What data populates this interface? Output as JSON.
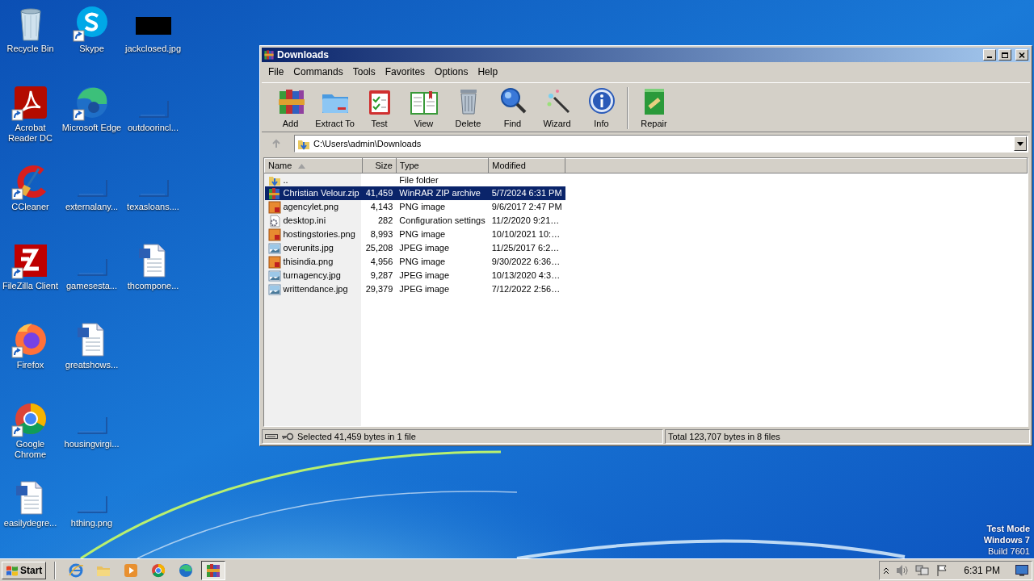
{
  "desktop_icons": [
    {
      "label": "Recycle Bin",
      "kind": "recycle",
      "shortcut": false
    },
    {
      "label": "Acrobat Reader DC",
      "kind": "acrobat",
      "shortcut": true
    },
    {
      "label": "CCleaner",
      "kind": "ccleaner",
      "shortcut": true
    },
    {
      "label": "FileZilla Client",
      "kind": "filezilla",
      "shortcut": true
    },
    {
      "label": "Firefox",
      "kind": "firefox",
      "shortcut": true
    },
    {
      "label": "Google Chrome",
      "kind": "chrome",
      "shortcut": true
    },
    {
      "label": "easilydegre...",
      "kind": "word",
      "shortcut": false
    },
    {
      "label": "Skype",
      "kind": "skype",
      "shortcut": true
    },
    {
      "label": "Microsoft Edge",
      "kind": "edge",
      "shortcut": true
    },
    {
      "label": "externalany...",
      "kind": "blank",
      "shortcut": false
    },
    {
      "label": "gamesesta...",
      "kind": "blank",
      "shortcut": false
    },
    {
      "label": "greatshows...",
      "kind": "word",
      "shortcut": false
    },
    {
      "label": "housingvirgi...",
      "kind": "blank",
      "shortcut": false
    },
    {
      "label": "hthing.png",
      "kind": "blank",
      "shortcut": false
    },
    {
      "label": "jackclosed.jpg",
      "kind": "black",
      "shortcut": false
    },
    {
      "label": "outdoorincl...",
      "kind": "blank",
      "shortcut": false
    },
    {
      "label": "texasloans....",
      "kind": "blank",
      "shortcut": false
    },
    {
      "label": "thcompone...",
      "kind": "word",
      "shortcut": false
    }
  ],
  "window": {
    "title": "Downloads",
    "menu": [
      "File",
      "Commands",
      "Tools",
      "Favorites",
      "Options",
      "Help"
    ],
    "toolbar": [
      {
        "label": "Add",
        "kind": "add",
        "separator_before": false
      },
      {
        "label": "Extract To",
        "kind": "extract",
        "separator_before": false
      },
      {
        "label": "Test",
        "kind": "test",
        "separator_before": false
      },
      {
        "label": "View",
        "kind": "view",
        "separator_before": false
      },
      {
        "label": "Delete",
        "kind": "delete",
        "separator_before": false
      },
      {
        "label": "Find",
        "kind": "find",
        "separator_before": false
      },
      {
        "label": "Wizard",
        "kind": "wizard",
        "separator_before": false
      },
      {
        "label": "Info",
        "kind": "info",
        "separator_before": false
      },
      {
        "label": "Repair",
        "kind": "repair",
        "separator_before": true
      }
    ],
    "address": {
      "path": "C:\\Users\\admin\\Downloads"
    },
    "file_list": {
      "columns": [
        {
          "label": "Name",
          "sorted": true
        },
        {
          "label": "Size",
          "sorted": false
        },
        {
          "label": "Type",
          "sorted": false
        },
        {
          "label": "Modified",
          "sorted": false
        }
      ],
      "rows": [
        {
          "name": "..",
          "size": "",
          "type": "File folder",
          "modified": "",
          "kind": "up",
          "selected": false
        },
        {
          "name": "Christian Velour.zip",
          "size": "41,459",
          "type": "WinRAR ZIP archive",
          "modified": "5/7/2024 6:31 PM",
          "kind": "zip",
          "selected": true
        },
        {
          "name": "agencylet.png",
          "size": "4,143",
          "type": "PNG image",
          "modified": "9/6/2017 2:47 PM",
          "kind": "png",
          "selected": false
        },
        {
          "name": "desktop.ini",
          "size": "282",
          "type": "Configuration settings",
          "modified": "11/2/2020 9:21…",
          "kind": "ini",
          "selected": false
        },
        {
          "name": "hostingstories.png",
          "size": "8,993",
          "type": "PNG image",
          "modified": "10/10/2021 10:…",
          "kind": "png",
          "selected": false
        },
        {
          "name": "overunits.jpg",
          "size": "25,208",
          "type": "JPEG image",
          "modified": "11/25/2017 6:2…",
          "kind": "jpg",
          "selected": false
        },
        {
          "name": "thisindia.png",
          "size": "4,956",
          "type": "PNG image",
          "modified": "9/30/2022 6:36…",
          "kind": "png",
          "selected": false
        },
        {
          "name": "turnagency.jpg",
          "size": "9,287",
          "type": "JPEG image",
          "modified": "10/13/2020 4:3…",
          "kind": "jpg",
          "selected": false
        },
        {
          "name": "writtendance.jpg",
          "size": "29,379",
          "type": "JPEG image",
          "modified": "7/12/2022 2:56…",
          "kind": "jpg",
          "selected": false
        }
      ]
    },
    "status_bar": {
      "selected": "Selected 41,459 bytes in 1 file",
      "total": "Total 123,707 bytes in 8 files"
    }
  },
  "system_notice": [
    "Test Mode",
    "Windows 7",
    "Build 7601"
  ],
  "taskbar": {
    "start": "Start",
    "items": [
      {
        "kind": "ie",
        "active": false
      },
      {
        "kind": "explorer",
        "active": false
      },
      {
        "kind": "media",
        "active": false
      },
      {
        "kind": "chrome",
        "active": false
      },
      {
        "kind": "edge",
        "active": false
      },
      {
        "kind": "winrar",
        "active": true
      }
    ],
    "clock": "6:31 PM"
  }
}
